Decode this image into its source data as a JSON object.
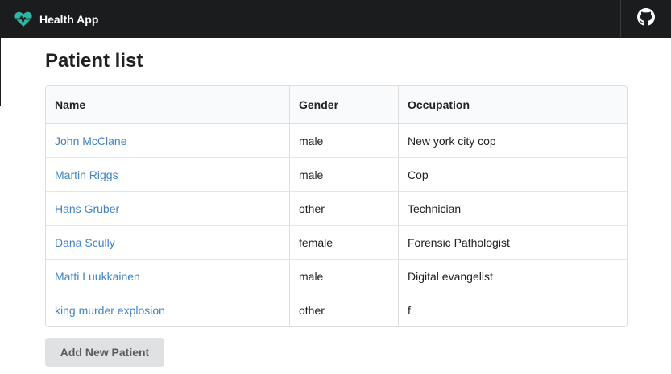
{
  "navbar": {
    "brand_label": "Health App",
    "brand_icon": "heartbeat-icon",
    "brand_color": "#2fb5a2",
    "right_icon": "github-icon"
  },
  "page": {
    "title": "Patient list"
  },
  "table": {
    "headers": {
      "name": "Name",
      "gender": "Gender",
      "occupation": "Occupation"
    },
    "rows": [
      {
        "name": "John McClane",
        "gender": "male",
        "occupation": "New york city cop"
      },
      {
        "name": "Martin Riggs",
        "gender": "male",
        "occupation": "Cop"
      },
      {
        "name": "Hans Gruber",
        "gender": "other",
        "occupation": "Technician"
      },
      {
        "name": "Dana Scully",
        "gender": "female",
        "occupation": "Forensic Pathologist"
      },
      {
        "name": "Matti Luukkainen",
        "gender": "male",
        "occupation": "Digital evangelist"
      },
      {
        "name": "king murder explosion",
        "gender": "other",
        "occupation": "f"
      }
    ]
  },
  "actions": {
    "add_patient_label": "Add New Patient"
  },
  "colors": {
    "link": "#4183c4",
    "navbar_bg": "#1b1c1d",
    "button_bg": "#e0e1e2"
  }
}
